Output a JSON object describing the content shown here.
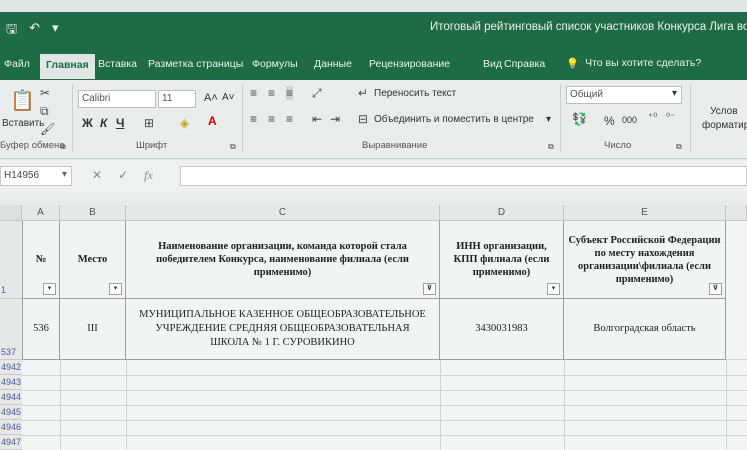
{
  "window": {
    "title": "Итоговый рейтинговый список участников Конкурса Лига возмож"
  },
  "tabs": [
    "Файл",
    "Главная",
    "Вставка",
    "Разметка страницы",
    "Формулы",
    "Данные",
    "Рецензирование",
    "Вид",
    "Справка"
  ],
  "tell_me": "Что вы хотите сделать?",
  "ribbon": {
    "paste_label": "Вставить",
    "clipboard_group": "Буфер обмена",
    "font_name": "Calibri",
    "font_size": "11",
    "bold": "Ж",
    "italic": "К",
    "underline": "Ч",
    "font_group": "Шрифт",
    "wrap_text": "Переносить текст",
    "merge_center": "Объединить и поместить в центре",
    "alignment_group": "Выравнивание",
    "number_format": "Общий",
    "percent": "%",
    "thousands": "000",
    "number_group": "Число",
    "conditional_1": "Услов",
    "conditional_2": "форматир"
  },
  "formula_bar": {
    "name_box": "H14956",
    "fx": "fx"
  },
  "columns": [
    "A",
    "B",
    "C",
    "D",
    "E"
  ],
  "header_row_number": "1",
  "headers": {
    "a": "№",
    "b": "Место",
    "c": "Наименование организации, команда которой стала победителем Конкурса, наименование филиала (если применимо)",
    "d": "ИНН организации, КПП филиала (если применимо)",
    "e": "Субъект Российской Федерации по месту нахождения организации\\филиала (если применимо)"
  },
  "record": {
    "row_number": "537",
    "num": "536",
    "place": "III",
    "org": "МУНИЦИПАЛЬНОЕ КАЗЕННОЕ ОБЩЕОБРАЗОВАТЕЛЬНОЕ УЧРЕЖДЕНИЕ СРЕДНЯЯ ОБЩЕОБРАЗОВАТЕЛЬНАЯ ШКОЛА № 1 Г. СУРОВИКИНО",
    "inn": "3430031983",
    "region": "Волгоградская область"
  },
  "empty_rows": [
    "4942",
    "4943",
    "4944",
    "4945",
    "4946",
    "4947"
  ]
}
